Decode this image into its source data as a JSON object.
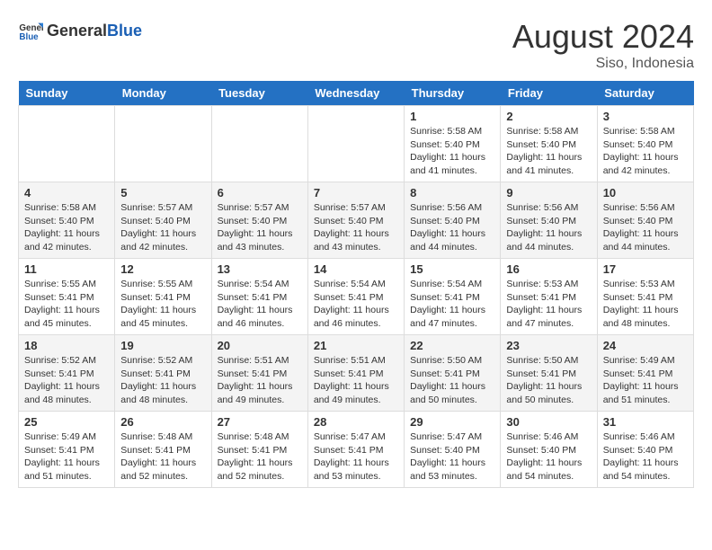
{
  "header": {
    "logo_general": "General",
    "logo_blue": "Blue",
    "month_year": "August 2024",
    "location": "Siso, Indonesia"
  },
  "days_of_week": [
    "Sunday",
    "Monday",
    "Tuesday",
    "Wednesday",
    "Thursday",
    "Friday",
    "Saturday"
  ],
  "weeks": [
    {
      "days": [
        {
          "num": "",
          "info": ""
        },
        {
          "num": "",
          "info": ""
        },
        {
          "num": "",
          "info": ""
        },
        {
          "num": "",
          "info": ""
        },
        {
          "num": "1",
          "info": "Sunrise: 5:58 AM\nSunset: 5:40 PM\nDaylight: 11 hours\nand 41 minutes."
        },
        {
          "num": "2",
          "info": "Sunrise: 5:58 AM\nSunset: 5:40 PM\nDaylight: 11 hours\nand 41 minutes."
        },
        {
          "num": "3",
          "info": "Sunrise: 5:58 AM\nSunset: 5:40 PM\nDaylight: 11 hours\nand 42 minutes."
        }
      ]
    },
    {
      "days": [
        {
          "num": "4",
          "info": "Sunrise: 5:58 AM\nSunset: 5:40 PM\nDaylight: 11 hours\nand 42 minutes."
        },
        {
          "num": "5",
          "info": "Sunrise: 5:57 AM\nSunset: 5:40 PM\nDaylight: 11 hours\nand 42 minutes."
        },
        {
          "num": "6",
          "info": "Sunrise: 5:57 AM\nSunset: 5:40 PM\nDaylight: 11 hours\nand 43 minutes."
        },
        {
          "num": "7",
          "info": "Sunrise: 5:57 AM\nSunset: 5:40 PM\nDaylight: 11 hours\nand 43 minutes."
        },
        {
          "num": "8",
          "info": "Sunrise: 5:56 AM\nSunset: 5:40 PM\nDaylight: 11 hours\nand 44 minutes."
        },
        {
          "num": "9",
          "info": "Sunrise: 5:56 AM\nSunset: 5:40 PM\nDaylight: 11 hours\nand 44 minutes."
        },
        {
          "num": "10",
          "info": "Sunrise: 5:56 AM\nSunset: 5:40 PM\nDaylight: 11 hours\nand 44 minutes."
        }
      ]
    },
    {
      "days": [
        {
          "num": "11",
          "info": "Sunrise: 5:55 AM\nSunset: 5:41 PM\nDaylight: 11 hours\nand 45 minutes."
        },
        {
          "num": "12",
          "info": "Sunrise: 5:55 AM\nSunset: 5:41 PM\nDaylight: 11 hours\nand 45 minutes."
        },
        {
          "num": "13",
          "info": "Sunrise: 5:54 AM\nSunset: 5:41 PM\nDaylight: 11 hours\nand 46 minutes."
        },
        {
          "num": "14",
          "info": "Sunrise: 5:54 AM\nSunset: 5:41 PM\nDaylight: 11 hours\nand 46 minutes."
        },
        {
          "num": "15",
          "info": "Sunrise: 5:54 AM\nSunset: 5:41 PM\nDaylight: 11 hours\nand 47 minutes."
        },
        {
          "num": "16",
          "info": "Sunrise: 5:53 AM\nSunset: 5:41 PM\nDaylight: 11 hours\nand 47 minutes."
        },
        {
          "num": "17",
          "info": "Sunrise: 5:53 AM\nSunset: 5:41 PM\nDaylight: 11 hours\nand 48 minutes."
        }
      ]
    },
    {
      "days": [
        {
          "num": "18",
          "info": "Sunrise: 5:52 AM\nSunset: 5:41 PM\nDaylight: 11 hours\nand 48 minutes."
        },
        {
          "num": "19",
          "info": "Sunrise: 5:52 AM\nSunset: 5:41 PM\nDaylight: 11 hours\nand 48 minutes."
        },
        {
          "num": "20",
          "info": "Sunrise: 5:51 AM\nSunset: 5:41 PM\nDaylight: 11 hours\nand 49 minutes."
        },
        {
          "num": "21",
          "info": "Sunrise: 5:51 AM\nSunset: 5:41 PM\nDaylight: 11 hours\nand 49 minutes."
        },
        {
          "num": "22",
          "info": "Sunrise: 5:50 AM\nSunset: 5:41 PM\nDaylight: 11 hours\nand 50 minutes."
        },
        {
          "num": "23",
          "info": "Sunrise: 5:50 AM\nSunset: 5:41 PM\nDaylight: 11 hours\nand 50 minutes."
        },
        {
          "num": "24",
          "info": "Sunrise: 5:49 AM\nSunset: 5:41 PM\nDaylight: 11 hours\nand 51 minutes."
        }
      ]
    },
    {
      "days": [
        {
          "num": "25",
          "info": "Sunrise: 5:49 AM\nSunset: 5:41 PM\nDaylight: 11 hours\nand 51 minutes."
        },
        {
          "num": "26",
          "info": "Sunrise: 5:48 AM\nSunset: 5:41 PM\nDaylight: 11 hours\nand 52 minutes."
        },
        {
          "num": "27",
          "info": "Sunrise: 5:48 AM\nSunset: 5:41 PM\nDaylight: 11 hours\nand 52 minutes."
        },
        {
          "num": "28",
          "info": "Sunrise: 5:47 AM\nSunset: 5:41 PM\nDaylight: 11 hours\nand 53 minutes."
        },
        {
          "num": "29",
          "info": "Sunrise: 5:47 AM\nSunset: 5:40 PM\nDaylight: 11 hours\nand 53 minutes."
        },
        {
          "num": "30",
          "info": "Sunrise: 5:46 AM\nSunset: 5:40 PM\nDaylight: 11 hours\nand 54 minutes."
        },
        {
          "num": "31",
          "info": "Sunrise: 5:46 AM\nSunset: 5:40 PM\nDaylight: 11 hours\nand 54 minutes."
        }
      ]
    }
  ]
}
